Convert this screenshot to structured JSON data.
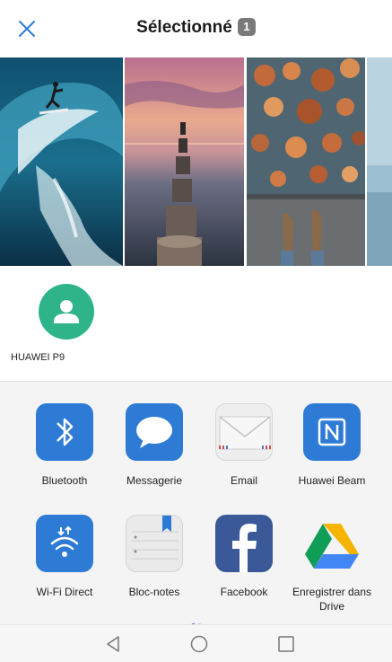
{
  "header": {
    "title": "Sélectionné",
    "selected_count": "1",
    "close_icon": "close-icon"
  },
  "photos": [
    {
      "name": "surfer-wave-photo"
    },
    {
      "name": "sunset-pier-photo"
    },
    {
      "name": "autumn-leaves-photo"
    },
    {
      "name": "frozen-lake-photo"
    }
  ],
  "contacts": [
    {
      "label": "HUAWEI P9",
      "icon": "person-icon",
      "color": "#2eb38a"
    }
  ],
  "apps": [
    {
      "label": "Bluetooth",
      "icon": "bluetooth-icon",
      "color": "#2e7bd6"
    },
    {
      "label": "Messagerie",
      "icon": "message-bubble-icon",
      "color": "#2e7bd6"
    },
    {
      "label": "Email",
      "icon": "envelope-icon",
      "color": "#eeeeee"
    },
    {
      "label": "Huawei Beam",
      "icon": "nfc-icon",
      "color": "#2e7bd6"
    },
    {
      "label": "Wi-Fi Direct",
      "icon": "wifi-direct-icon",
      "color": "#2e7bd6"
    },
    {
      "label": "Bloc-notes",
      "icon": "notepad-icon",
      "color": "#eaeaea"
    },
    {
      "label": "Facebook",
      "icon": "facebook-icon",
      "color": "#3b5998"
    },
    {
      "label": "Enregistrer dans Drive",
      "icon": "google-drive-icon",
      "color": "#ffffff"
    }
  ],
  "pager": {
    "pages": 2,
    "current": 1,
    "active_color": "#2e7bd6",
    "inactive_color": "#c8c8c8"
  },
  "navigation": {
    "back": "back-triangle-icon",
    "home": "home-circle-icon",
    "recents": "recents-square-icon"
  }
}
